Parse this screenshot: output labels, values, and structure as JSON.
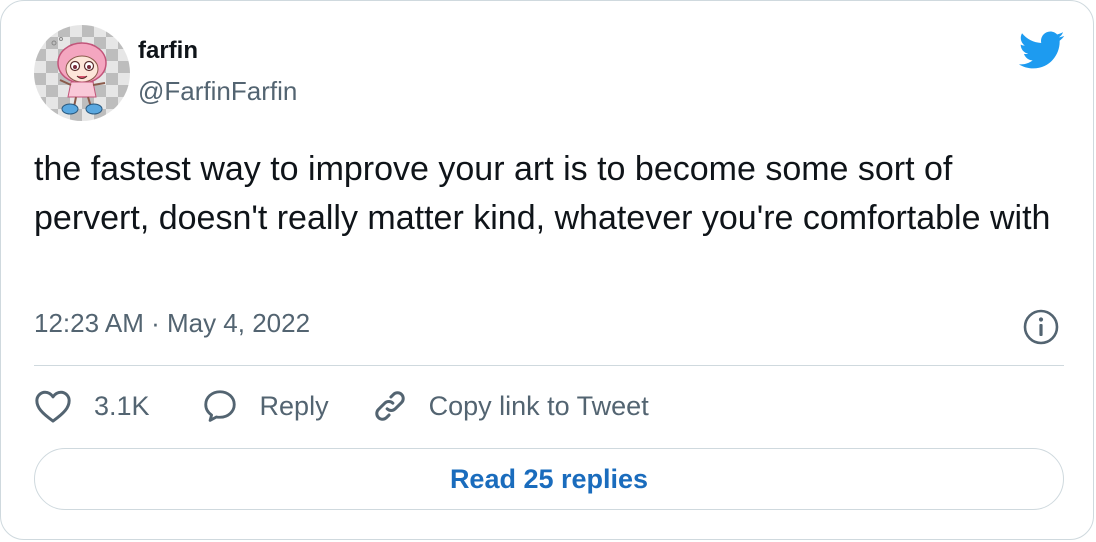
{
  "author": {
    "display_name": "farfin",
    "handle": "@FarfinFarfin"
  },
  "tweet": {
    "text": "the fastest way to improve your art is to become some sort of pervert, doesn't really matter kind, whatever you're comfortable with",
    "timestamp": "12:23 AM · May 4, 2022"
  },
  "actions": {
    "like_count": "3.1K",
    "reply_label": "Reply",
    "copy_label": "Copy link to Tweet"
  },
  "read_replies_label": "Read 25 replies",
  "icons": {
    "brand": "twitter-bird-icon",
    "info": "info-icon",
    "like": "heart-icon",
    "reply": "speech-bubble-icon",
    "copy": "link-icon"
  },
  "colors": {
    "twitter_blue": "#1d9bf0",
    "link_blue": "#1a6cbd",
    "muted_text": "#536471",
    "border": "#cfd9de"
  }
}
